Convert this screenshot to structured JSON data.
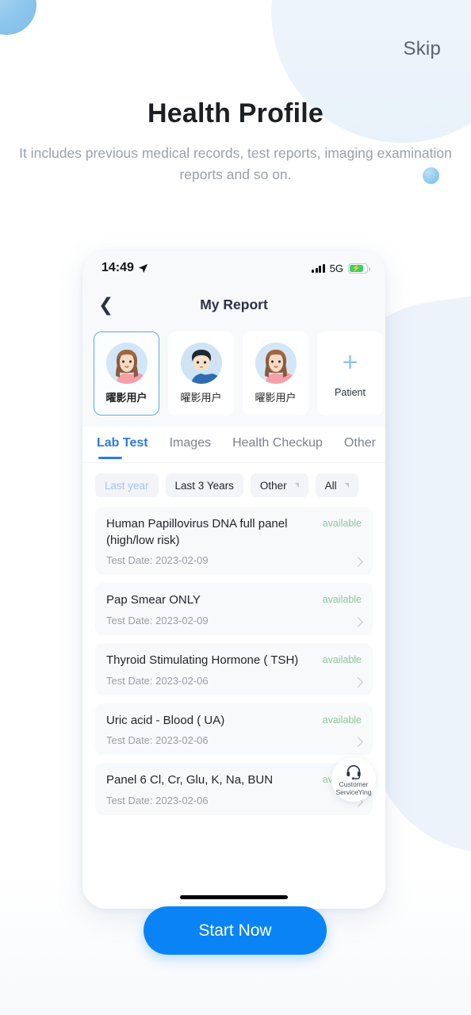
{
  "onboarding": {
    "skip_label": "Skip",
    "title": "Health Profile",
    "subtitle": "It includes previous medical records, test reports, imaging examination reports and so on.",
    "cta_label": "Start Now",
    "accent_color": "#0a84f5"
  },
  "phone": {
    "status_bar": {
      "time": "14:49",
      "location_icon": "location-arrow-icon",
      "signal_icon": "signal-bars-icon",
      "network": "5G",
      "battery_icon": "battery-charging-icon",
      "bolt": "⚡"
    },
    "nav": {
      "back_icon": "chevron-left-icon",
      "title": "My Report"
    },
    "patients": [
      {
        "name": "曜影用户",
        "avatar": "avatar-woman-brown-hair",
        "selected": true
      },
      {
        "name": "曜影用户",
        "avatar": "avatar-man-dark-hair",
        "selected": false
      },
      {
        "name": "曜影用户",
        "avatar": "avatar-woman-brown-hair",
        "selected": false
      },
      {
        "name": "Patient",
        "avatar": "plus-icon",
        "selected": false,
        "is_add": true
      }
    ],
    "tabs": [
      {
        "label": "Lab Test",
        "active": true
      },
      {
        "label": "Images",
        "active": false
      },
      {
        "label": "Health Checkup",
        "active": false
      },
      {
        "label": "Other",
        "active": false
      }
    ],
    "filters": [
      {
        "label": "Last year",
        "muted": true,
        "has_caret": false
      },
      {
        "label": "Last 3 Years",
        "muted": false,
        "has_caret": false
      },
      {
        "label": "Other",
        "muted": false,
        "has_caret": true
      },
      {
        "label": "All",
        "muted": false,
        "has_caret": true
      }
    ],
    "reports": [
      {
        "name": "Human Papillovirus DNA full panel (high/low risk)",
        "status": "available",
        "date": "Test Date: 2023-02-09"
      },
      {
        "name": "Pap Smear ONLY",
        "status": "available",
        "date": "Test Date: 2023-02-09"
      },
      {
        "name": "Thyroid Stimulating Hormone ( TSH)",
        "status": "available",
        "date": "Test Date: 2023-02-06"
      },
      {
        "name": "Uric acid - Blood ( UA)",
        "status": "available",
        "date": "Test Date: 2023-02-06"
      },
      {
        "name": "Panel 6 Cl, Cr, Glu, K, Na, BUN",
        "status": "available",
        "date": "Test Date: 2023-02-06"
      }
    ],
    "customer_service": {
      "icon": "headset-icon",
      "line1": "Customer",
      "line2": "ServiceYing"
    },
    "status_color": "#8ec79a",
    "tab_active_color": "#2b7ae4"
  }
}
